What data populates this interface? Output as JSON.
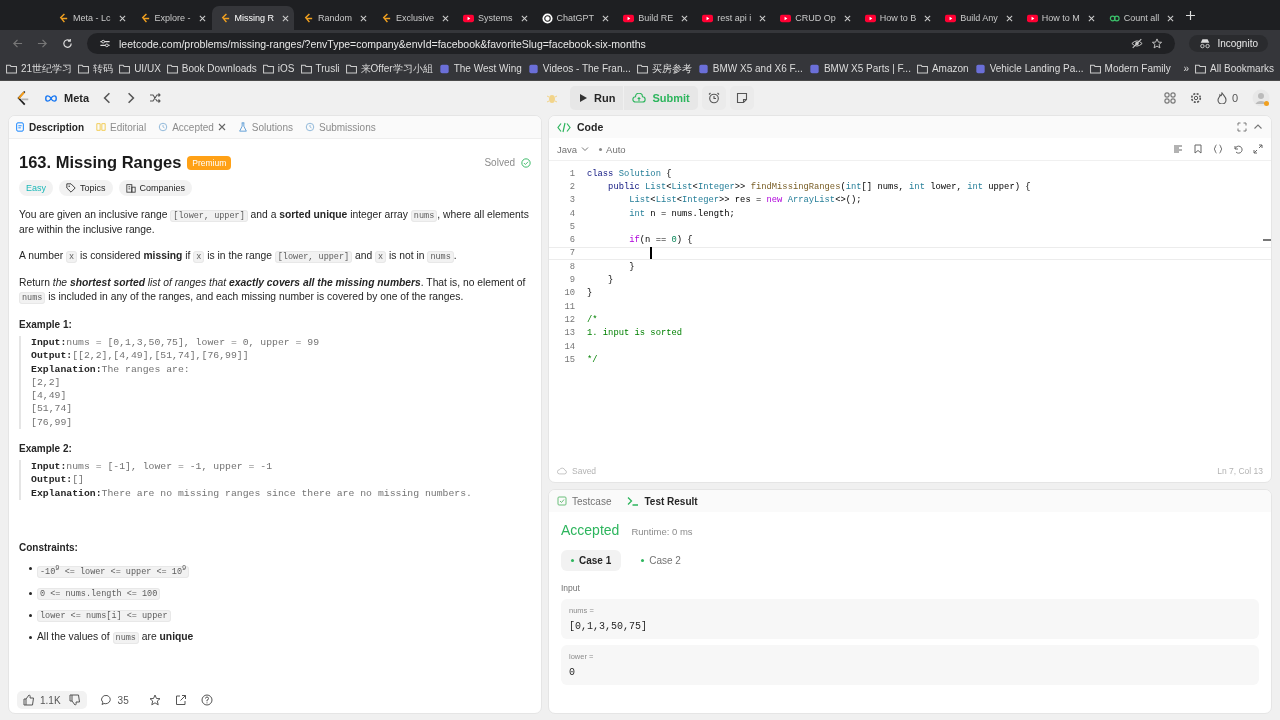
{
  "browser": {
    "tabs": [
      {
        "label": "Meta - Lc",
        "kind": "leetcode",
        "selected": false
      },
      {
        "label": "Explore -",
        "kind": "leetcode",
        "selected": false
      },
      {
        "label": "Missing R",
        "kind": "leetcode",
        "selected": true
      },
      {
        "label": "Random",
        "kind": "leetcode",
        "selected": false
      },
      {
        "label": "Exclusive",
        "kind": "leetcode",
        "selected": false
      },
      {
        "label": "Systems",
        "kind": "video",
        "selected": false
      },
      {
        "label": "ChatGPT",
        "kind": "chat",
        "selected": false
      },
      {
        "label": "Build RE",
        "kind": "video",
        "selected": false
      },
      {
        "label": "rest api i",
        "kind": "video",
        "selected": false
      },
      {
        "label": "CRUD Op",
        "kind": "video",
        "selected": false
      },
      {
        "label": "How to B",
        "kind": "video",
        "selected": false
      },
      {
        "label": "Build Any",
        "kind": "video",
        "selected": false
      },
      {
        "label": "How to M",
        "kind": "video",
        "selected": false
      },
      {
        "label": "Count all",
        "kind": "site",
        "selected": false
      }
    ],
    "url": "leetcode.com/problems/missing-ranges/?envType=company&envId=facebook&favoriteSlug=facebook-six-months",
    "profile": "Incognito",
    "bookmarks": [
      {
        "label": "21世纪学习",
        "kind": "folder"
      },
      {
        "label": "转码",
        "kind": "folder"
      },
      {
        "label": "UI/UX",
        "kind": "folder"
      },
      {
        "label": "Book Downloads",
        "kind": "folder"
      },
      {
        "label": "iOS",
        "kind": "folder"
      },
      {
        "label": "Trusli",
        "kind": "folder"
      },
      {
        "label": "来Offer学习小組",
        "kind": "folder"
      },
      {
        "label": "The West Wing",
        "kind": "site"
      },
      {
        "label": "Videos - The Fran...",
        "kind": "site"
      },
      {
        "label": "买房参考",
        "kind": "folder"
      },
      {
        "label": "BMW X5 and X6 F...",
        "kind": "site"
      },
      {
        "label": "BMW X5 Parts | F...",
        "kind": "site"
      },
      {
        "label": "Amazon",
        "kind": "folder"
      },
      {
        "label": "Vehicle Landing Pa...",
        "kind": "site"
      },
      {
        "label": "Modern Family",
        "kind": "folder"
      }
    ],
    "more": "»",
    "all_bookmarks": "All Bookmarks"
  },
  "nav": {
    "list_name": "Meta",
    "run": "Run",
    "submit": "Submit",
    "streak": "0"
  },
  "description": {
    "tabs": [
      {
        "label": "Description",
        "kind": "doc",
        "selected": true,
        "closable": false
      },
      {
        "label": "Editorial",
        "kind": "book",
        "selected": false,
        "closable": false
      },
      {
        "label": "Accepted",
        "kind": "history",
        "selected": false,
        "closable": true
      },
      {
        "label": "Solutions",
        "kind": "flask",
        "selected": false,
        "closable": false
      },
      {
        "label": "Submissions",
        "kind": "history",
        "selected": false,
        "closable": false
      }
    ],
    "title": "163. Missing Ranges",
    "badge": "Premium",
    "status": "Solved",
    "difficulty": "Easy",
    "tags": [
      {
        "label": "Topics",
        "kind": "tag"
      },
      {
        "label": "Companies",
        "kind": "building"
      }
    ],
    "paragraphs": [
      [
        {
          "kind": "plain",
          "text": "You are given an inclusive range "
        },
        {
          "kind": "code",
          "text": "[lower, upper]"
        },
        {
          "kind": "plain",
          "text": " and a "
        },
        {
          "kind": "bold",
          "text": "sorted unique"
        },
        {
          "kind": "plain",
          "text": " integer array "
        },
        {
          "kind": "code",
          "text": "nums"
        },
        {
          "kind": "plain",
          "text": ", where all elements are within the inclusive range."
        }
      ],
      [
        {
          "kind": "plain",
          "text": "A number "
        },
        {
          "kind": "code",
          "text": "x"
        },
        {
          "kind": "plain",
          "text": " is considered "
        },
        {
          "kind": "bold",
          "text": "missing"
        },
        {
          "kind": "plain",
          "text": " if "
        },
        {
          "kind": "code",
          "text": "x"
        },
        {
          "kind": "plain",
          "text": " is in the range "
        },
        {
          "kind": "code",
          "text": "[lower, upper]"
        },
        {
          "kind": "plain",
          "text": " and "
        },
        {
          "kind": "code",
          "text": "x"
        },
        {
          "kind": "plain",
          "text": " is not in "
        },
        {
          "kind": "code",
          "text": "nums"
        },
        {
          "kind": "plain",
          "text": "."
        }
      ],
      [
        {
          "kind": "plain",
          "text": "Return "
        },
        {
          "kind": "italic",
          "text": "the "
        },
        {
          "kind": "bolditalic",
          "text": "shortest sorted"
        },
        {
          "kind": "italic",
          "text": " list of ranges that "
        },
        {
          "kind": "bolditalic",
          "text": "exactly covers all the missing numbers"
        },
        {
          "kind": "plain",
          "text": ". That is, no element of "
        },
        {
          "kind": "code",
          "text": "nums"
        },
        {
          "kind": "plain",
          "text": " is included in any of the ranges, and each missing number is covered by one of the ranges."
        }
      ]
    ],
    "examples": [
      {
        "heading": "Example 1:",
        "lines": [
          {
            "label": "Input:",
            "text": "nums = [0,1,3,50,75], lower = 0, upper = 99"
          },
          {
            "label": "Output:",
            "text": "[[2,2],[4,49],[51,74],[76,99]]"
          },
          {
            "label": "Explanation:",
            "text": "The ranges are:"
          },
          {
            "text": "[2,2]"
          },
          {
            "text": "[4,49]"
          },
          {
            "text": "[51,74]"
          },
          {
            "text": "[76,99]"
          }
        ]
      },
      {
        "heading": "Example 2:",
        "lines": [
          {
            "label": "Input:",
            "text": "nums = [-1], lower = -1, upper = -1"
          },
          {
            "label": "Output:",
            "text": "[]"
          },
          {
            "label": "Explanation:",
            "text": "There are no missing ranges since there are no missing numbers."
          }
        ]
      }
    ],
    "constraints_heading": "Constraints:",
    "constraints": [
      [
        {
          "kind": "code",
          "text": "-10$^{9}$ <= lower <= upper <= 10$^{9}$"
        }
      ],
      [
        {
          "kind": "code",
          "text": "0 <= nums.length <= 100"
        }
      ],
      [
        {
          "kind": "code",
          "text": "lower <= nums[i] <= upper"
        }
      ],
      [
        {
          "kind": "plain",
          "text": "All the values of "
        },
        {
          "kind": "code",
          "text": "nums"
        },
        {
          "kind": "plain",
          "text": " are "
        },
        {
          "kind": "bold",
          "text": "unique"
        }
      ]
    ],
    "footer": {
      "likes": "1.1K",
      "comments": "35"
    }
  },
  "editor": {
    "title": "Code",
    "language": "Java",
    "mode": "Auto",
    "save_status": "Saved",
    "position": "Ln 7, Col 13",
    "lines": [
      {
        "number": "1",
        "current": false,
        "tokens": [
          {
            "kind": "kw",
            "text": "class "
          },
          {
            "kind": "type",
            "text": "Solution"
          },
          {
            "kind": "txt",
            "text": " {"
          }
        ]
      },
      {
        "number": "2",
        "current": false,
        "tokens": [
          {
            "kind": "kw",
            "text": "    public "
          },
          {
            "kind": "type",
            "text": "List"
          },
          {
            "kind": "txt",
            "text": "<"
          },
          {
            "kind": "type",
            "text": "List"
          },
          {
            "kind": "txt",
            "text": "<"
          },
          {
            "kind": "type",
            "text": "Integer"
          },
          {
            "kind": "txt",
            "text": ">> "
          },
          {
            "kind": "fn",
            "text": "findMissingRanges"
          },
          {
            "kind": "txt",
            "text": "("
          },
          {
            "kind": "type",
            "text": "int"
          },
          {
            "kind": "txt",
            "text": "[] nums, "
          },
          {
            "kind": "type",
            "text": "int"
          },
          {
            "kind": "txt",
            "text": " lower, "
          },
          {
            "kind": "type",
            "text": "int"
          },
          {
            "kind": "txt",
            "text": " upper) {"
          }
        ]
      },
      {
        "number": "3",
        "current": false,
        "tokens": [
          {
            "kind": "type",
            "text": "        List"
          },
          {
            "kind": "txt",
            "text": "<"
          },
          {
            "kind": "type",
            "text": "List"
          },
          {
            "kind": "txt",
            "text": "<"
          },
          {
            "kind": "type",
            "text": "Integer"
          },
          {
            "kind": "txt",
            "text": ">> res = "
          },
          {
            "kind": "ctl",
            "text": "new "
          },
          {
            "kind": "type",
            "text": "ArrayList"
          },
          {
            "kind": "txt",
            "text": "<>();"
          }
        ]
      },
      {
        "number": "4",
        "current": false,
        "tokens": [
          {
            "kind": "type",
            "text": "        int"
          },
          {
            "kind": "txt",
            "text": " n = nums.length;"
          }
        ]
      },
      {
        "number": "5",
        "current": false
      },
      {
        "number": "6",
        "current": false,
        "tokens": [
          {
            "kind": "ctl",
            "text": "        if"
          },
          {
            "kind": "txt",
            "text": "(n == "
          },
          {
            "kind": "num",
            "text": "0"
          },
          {
            "kind": "txt",
            "text": ") {"
          }
        ]
      },
      {
        "number": "7",
        "current": true
      },
      {
        "number": "8",
        "current": false,
        "tokens": [
          {
            "kind": "txt",
            "text": "        }"
          }
        ]
      },
      {
        "number": "9",
        "current": false,
        "tokens": [
          {
            "kind": "txt",
            "text": "    }"
          }
        ]
      },
      {
        "number": "10",
        "current": false,
        "tokens": [
          {
            "kind": "txt",
            "text": "}"
          }
        ]
      },
      {
        "number": "11",
        "current": false
      },
      {
        "number": "12",
        "current": false,
        "tokens": [
          {
            "kind": "cm",
            "text": "/*"
          }
        ]
      },
      {
        "number": "13",
        "current": false,
        "tokens": [
          {
            "kind": "cm",
            "text": "1. input is sorted"
          }
        ]
      },
      {
        "number": "14",
        "current": false
      },
      {
        "number": "15",
        "current": false,
        "tokens": [
          {
            "kind": "cm",
            "text": "*/"
          }
        ]
      }
    ]
  },
  "results": {
    "tabs": [
      {
        "label": "Testcase",
        "kind": "checkbox",
        "selected": false
      },
      {
        "label": "Test Result",
        "kind": "terminal",
        "selected": true
      }
    ],
    "verdict": "Accepted",
    "runtime": "Runtime: 0 ms",
    "cases": [
      {
        "label": "Case 1",
        "selected": true
      },
      {
        "label": "Case 2",
        "selected": false
      }
    ],
    "input_label": "Input",
    "params": [
      {
        "name": "nums =",
        "value": "[0,1,3,50,75]"
      },
      {
        "name": "lower =",
        "value": "0"
      }
    ]
  }
}
